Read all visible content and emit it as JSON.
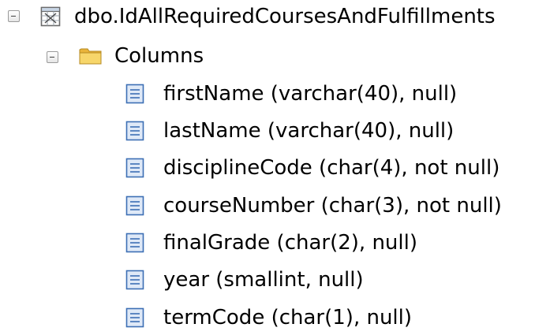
{
  "tree": {
    "view": {
      "label": "dbo.IdAllRequiredCoursesAndFulfillments",
      "icon": "view-table-icon",
      "expanded": true
    },
    "columns_folder": {
      "label": "Columns",
      "icon": "folder-icon",
      "expanded": true
    },
    "columns": [
      {
        "label": "firstName (varchar(40), null)",
        "icon": "column-icon"
      },
      {
        "label": "lastName (varchar(40), null)",
        "icon": "column-icon"
      },
      {
        "label": "disciplineCode (char(4), not null)",
        "icon": "column-icon"
      },
      {
        "label": "courseNumber (char(3), not null)",
        "icon": "column-icon"
      },
      {
        "label": "finalGrade (char(2), null)",
        "icon": "column-icon"
      },
      {
        "label": "year (smallint, null)",
        "icon": "column-icon"
      },
      {
        "label": "termCode (char(1), null)",
        "icon": "column-icon"
      }
    ]
  },
  "colors": {
    "folder": "#f3c64f",
    "column_icon": "#3d6fb5",
    "toggle_border": "#9a9a9a"
  }
}
